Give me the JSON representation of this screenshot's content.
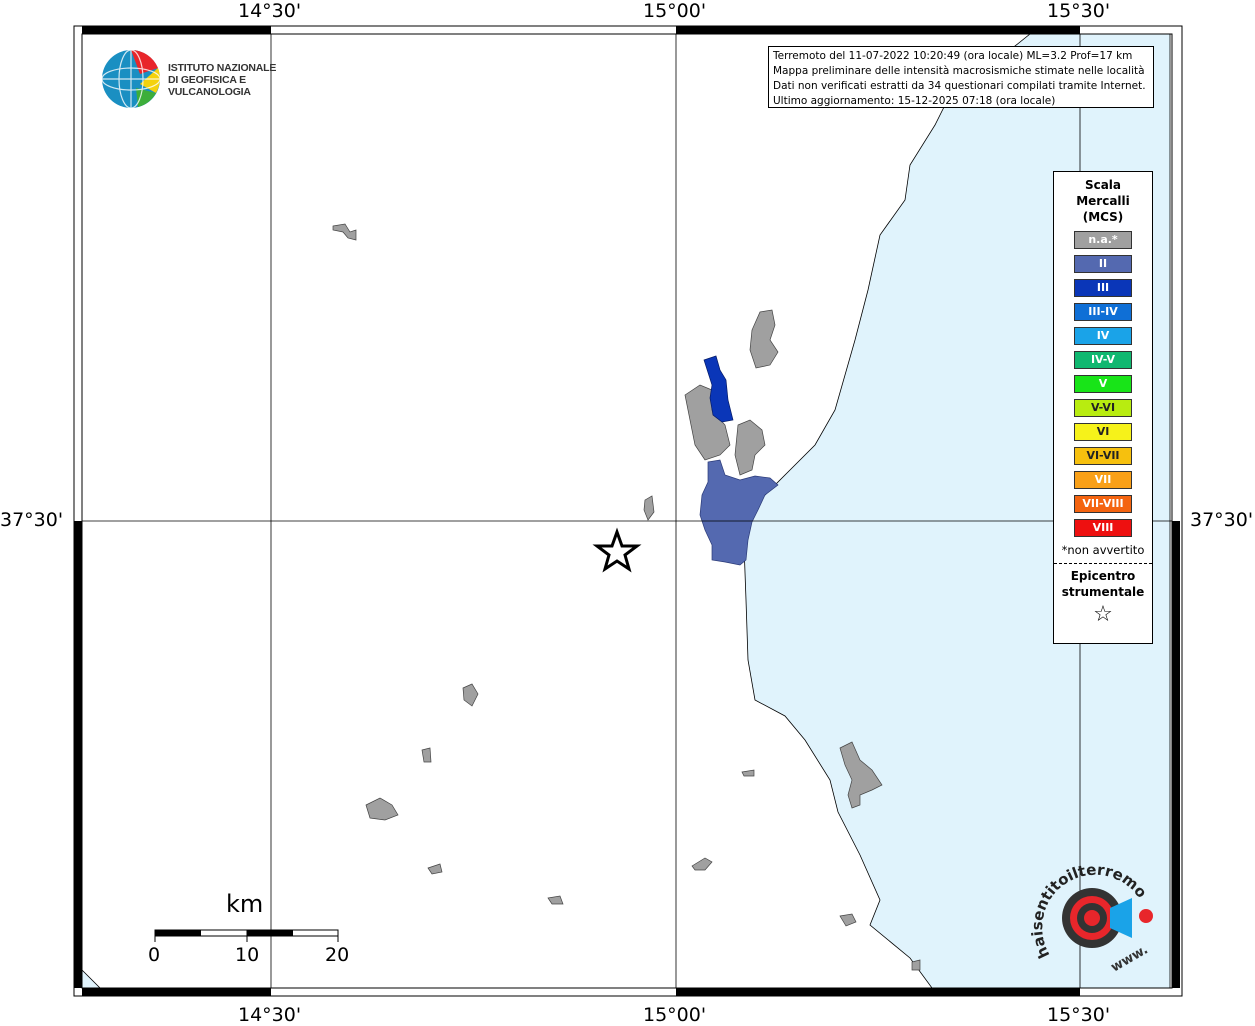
{
  "map": {
    "lon_labels": [
      "14°30'",
      "15°00'",
      "15°30'"
    ],
    "lat_labels": [
      "37°30'"
    ],
    "sea_color": "#e0f3fc",
    "land_color": "#ffffff"
  },
  "info": {
    "line1": "Terremoto del 11-07-2022 10:20:49 (ora locale) ML=3.2 Prof=17 km",
    "line2": "Mappa preliminare delle intensità macrosismiche stimate nelle località",
    "line3": "Dati non verificati estratti da 34 questionari compilati tramite Internet.",
    "line4": "Ultimo aggiornamento: 15-12-2025 07:18 (ora locale)"
  },
  "legend": {
    "title1": "Scala",
    "title2": "Mercalli",
    "title3": "(MCS)",
    "items": [
      {
        "label": "n.a.*",
        "color": "#a0a0a0"
      },
      {
        "label": "II",
        "color": "#5469b0"
      },
      {
        "label": "III",
        "color": "#0a36b8"
      },
      {
        "label": "III-IV",
        "color": "#0f6fd6"
      },
      {
        "label": "IV",
        "color": "#1aa3e8"
      },
      {
        "label": "IV-V",
        "color": "#10b870"
      },
      {
        "label": "V",
        "color": "#18e418"
      },
      {
        "label": "V-VI",
        "color": "#b8ec10"
      },
      {
        "label": "VI",
        "color": "#f6f21a"
      },
      {
        "label": "VI-VII",
        "color": "#f6c00e"
      },
      {
        "label": "VII",
        "color": "#f9a018"
      },
      {
        "label": "VII-VIII",
        "color": "#f46410"
      },
      {
        "label": "VIII",
        "color": "#ee1010"
      }
    ],
    "note": "*non avvertito",
    "epi1": "Epicentro",
    "epi2": "strumentale",
    "epi_symbol": "☆"
  },
  "ingv": {
    "line1": "ISTITUTO NAZIONALE",
    "line2": "DI GEOFISICA E VULCANOLOGIA"
  },
  "hst": {
    "brand": "haisentitoilterremoto.it",
    "url_prefix": "www."
  },
  "scale_bar": {
    "unit": "km",
    "labels": [
      "0",
      "10",
      "20"
    ]
  }
}
